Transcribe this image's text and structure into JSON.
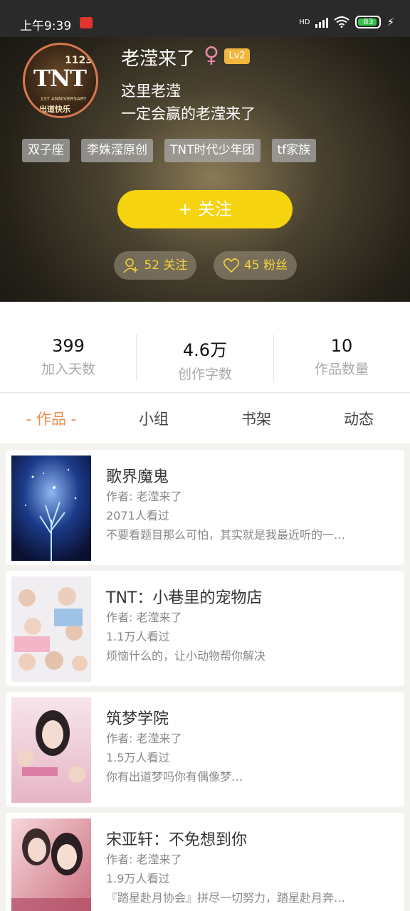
{
  "status_bar": {
    "time": "上午9:39",
    "network": "HD",
    "battery": "83"
  },
  "profile": {
    "avatar_text": {
      "main": "TNT",
      "number": "1123",
      "sub": "1ST ANNIVERSARY",
      "cn": "出道快乐"
    },
    "name": "老滢来了",
    "gender_symbol": "♀",
    "level": "Lv2",
    "bio_line1": "这里老滢",
    "bio_line2": "一定会赢的老滢来了",
    "tags": [
      "双子座",
      "李姝滢原创",
      "TNT时代少年团",
      "tf家族"
    ],
    "follow_button": "+  关注",
    "following": "52 关注",
    "fans": "45 粉丝"
  },
  "stats": [
    {
      "value": "399",
      "label": "加入天数"
    },
    {
      "value": "4.6万",
      "label": "创作字数"
    },
    {
      "value": "10",
      "label": "作品数量"
    }
  ],
  "tabs": [
    "- 作品 -",
    "小组",
    "书架",
    "动态"
  ],
  "works": [
    {
      "title": "歌界魔鬼",
      "author": "作者: 老滢来了",
      "views": "2071人看过",
      "desc": "不要看题目那么可怕，其实就是我最近听的一…"
    },
    {
      "title": "TNT：小巷里的宠物店",
      "author": "作者: 老滢来了",
      "views": "1.1万人看过",
      "desc": "烦恼什么的，让小动物帮你解决"
    },
    {
      "title": "筑梦学院",
      "author": "作者: 老滢来了",
      "views": "1.5万人看过",
      "desc": "你有出道梦吗你有偶像梦…"
    },
    {
      "title": "宋亚轩：不免想到你",
      "author": "作者: 老滢来了",
      "views": "1.9万人看过",
      "desc": "『踏星赴月协会』拼尽一切努力，踏星赴月奔…"
    }
  ],
  "colors": {
    "accent_yellow": "#f5d30f",
    "tab_active": "#f08a4a",
    "level_badge": "#f2b63f"
  }
}
